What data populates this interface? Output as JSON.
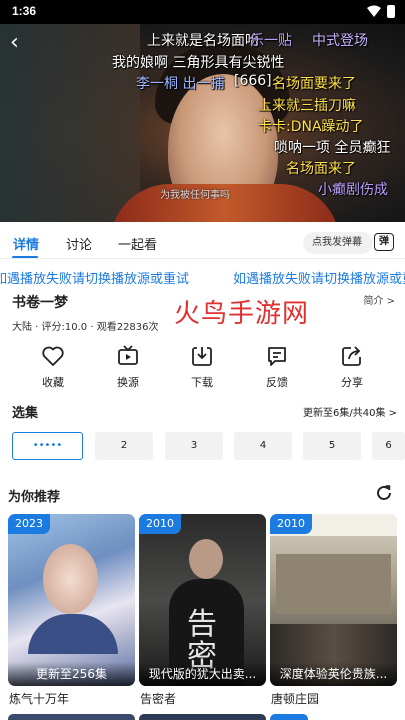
{
  "status_bar": {
    "time": "1:36"
  },
  "player": {
    "danmu": [
      {
        "text": "上来就是名场面哈",
        "color": "#ffffff"
      },
      {
        "text": "乐一贴",
        "color": "#b9a0ff"
      },
      {
        "text": "中式登场",
        "color": "#c8b4ff"
      },
      {
        "text": "我的娘啊 三角形具有尖锐性",
        "color": "#ffffff"
      },
      {
        "text": "李一桐 出一捕",
        "color": "#9bb6ff"
      },
      {
        "text": "[666]",
        "color": "#ffffff"
      },
      {
        "text": "名场面要来了",
        "color": "#ffe04a"
      },
      {
        "text": "上来就三插刀嘛",
        "color": "#ffe04a"
      },
      {
        "text": "卡卡:DNA躁动了",
        "color": "#ffe04a"
      },
      {
        "text": "唢呐一项 全员癫狂",
        "color": "#ffffff"
      },
      {
        "text": "名场面来了",
        "color": "#ffe04a"
      },
      {
        "text": "小癫剧伤成",
        "color": "#b9a0ff"
      }
    ],
    "subtitle": "为我被任何事吗"
  },
  "tabs": [
    "详情",
    "讨论",
    "一起看"
  ],
  "danmu_input_placeholder": "点我发弹幕",
  "danmu_toggle_label": "弹",
  "marquee_text": "如遇播放失败请切换播放源或重试",
  "show": {
    "title": "书卷一梦",
    "brief_label": "简介 >",
    "meta": "大陆 · 评分:10.0 · 观看22836次"
  },
  "watermark": "火鸟手游网",
  "actions": [
    {
      "label": "收藏",
      "icon": "heart-icon"
    },
    {
      "label": "换源",
      "icon": "tv-icon"
    },
    {
      "label": "下载",
      "icon": "download-icon"
    },
    {
      "label": "反馈",
      "icon": "feedback-icon"
    },
    {
      "label": "分享",
      "icon": "share-icon"
    }
  ],
  "episodes": {
    "title": "选集",
    "status": "更新至6集/共40集 >",
    "items": [
      "•••••",
      "2",
      "3",
      "4",
      "5",
      "6"
    ]
  },
  "recommend": {
    "title": "为你推荐",
    "cards": [
      {
        "year": "2023",
        "episode_label": "更新至256集",
        "name": "炼气十万年"
      },
      {
        "year": "2010",
        "episode_label": "现代版的犹大出卖...",
        "name": "告密者"
      },
      {
        "year": "2010",
        "episode_label": "深度体验英伦贵族...",
        "name": "唐顿庄园"
      }
    ]
  },
  "colors": {
    "accent": "#1b7be0",
    "watermark": "#e03030"
  }
}
